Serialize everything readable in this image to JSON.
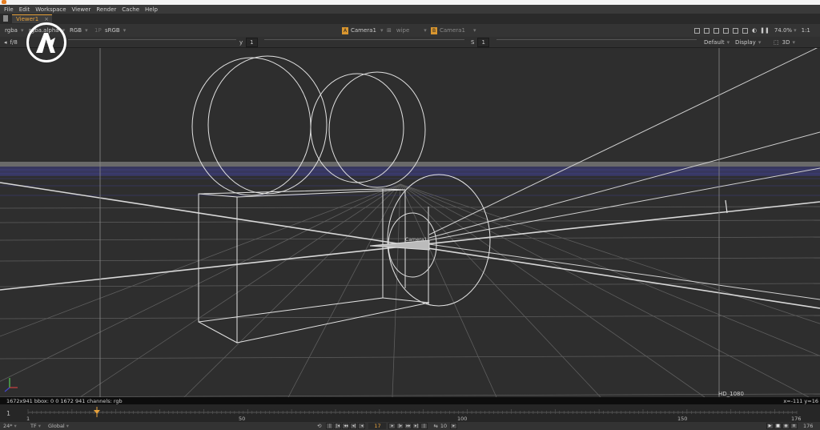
{
  "menu": [
    "File",
    "Edit",
    "Workspace",
    "Viewer",
    "Render",
    "Cache",
    "Help"
  ],
  "tab": {
    "label": "Viewer1",
    "close": "×"
  },
  "toolbar": {
    "channels": "rgba",
    "alpha": "rgba.alpha",
    "colorspace": "RGB",
    "lut": "sRGB",
    "input_a": "Camera1",
    "wipe": "wipe",
    "input_b": "Camera1",
    "zoom": "74.0%",
    "ratio": "1:1",
    "fstop": "f/8",
    "gain_label": "y",
    "gain_value": "1",
    "s_label": "S",
    "s_value": "1",
    "default": "Default",
    "display": "Display",
    "mode3d": "3D"
  },
  "viewport": {
    "camera_label": "Camera1",
    "format_label": "HD_1080"
  },
  "infobar": {
    "left": "1672x941  bbox: 0 0 1672 941 channels: rgb",
    "right": "x=-111 y=16"
  },
  "timeline": {
    "ticks": [
      "1",
      "50",
      "100",
      "150",
      "176"
    ],
    "current": "17",
    "start": "1",
    "end": "176"
  },
  "playbar": {
    "fps": "24*",
    "tf": "TF",
    "global": "Global",
    "frame": "17",
    "step": "10",
    "end": "176"
  },
  "colors": {
    "accent": "#e8a23c",
    "wire": "#e0e0e0",
    "grid": "#5a5a5a",
    "horizon": "#4a4aa0"
  }
}
